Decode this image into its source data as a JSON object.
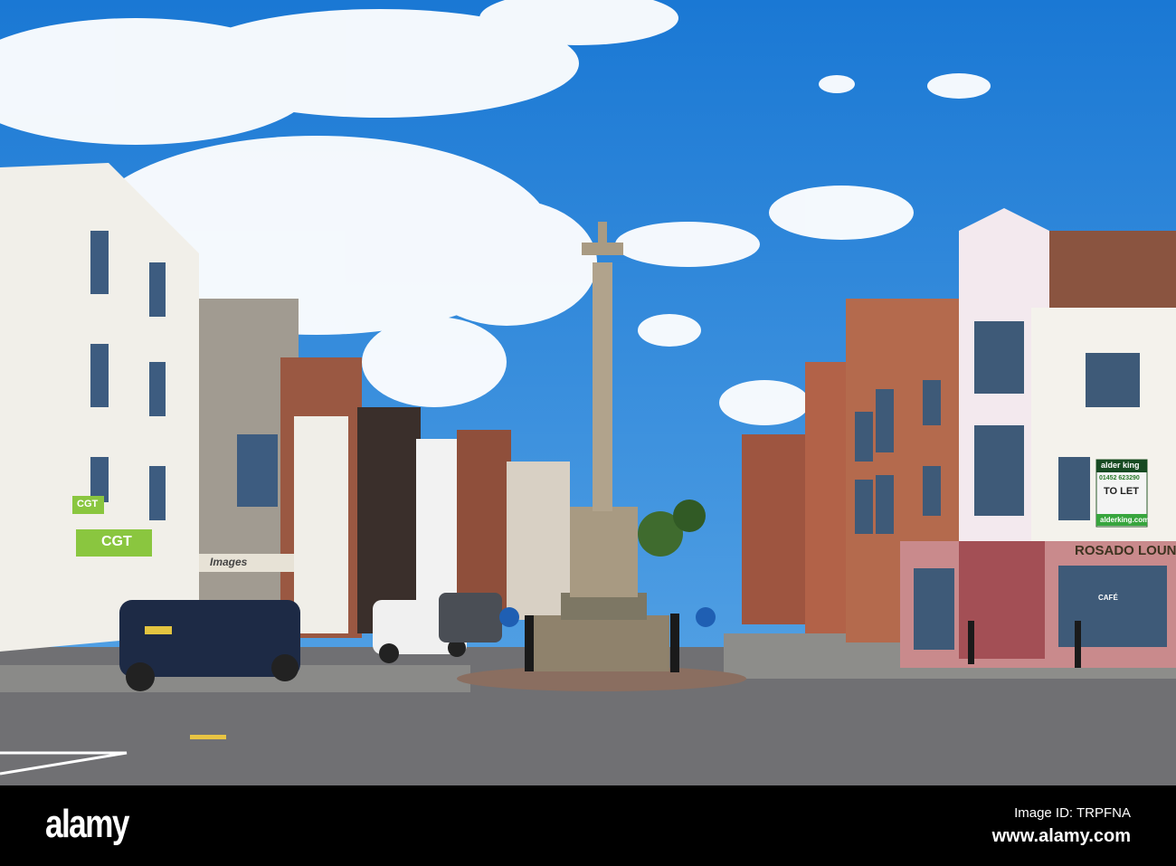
{
  "footer": {
    "logo": "alamy",
    "image_id": "Image ID: TRPFNA",
    "url": "www.alamy.com"
  },
  "signs": {
    "cgt": "CGT",
    "images_shop": "Images",
    "alder_king": "alder king",
    "phone": "01452 623290",
    "to_let": "TO LET",
    "agent_url": "alderking.com",
    "rosado": "ROSADO LOUNGE",
    "cafe": "CAFÉ"
  },
  "colors": {
    "sky": "#1f7fd6",
    "road": "#6e6e70",
    "brick": "#a9583d",
    "pink": "#c98a8c"
  }
}
